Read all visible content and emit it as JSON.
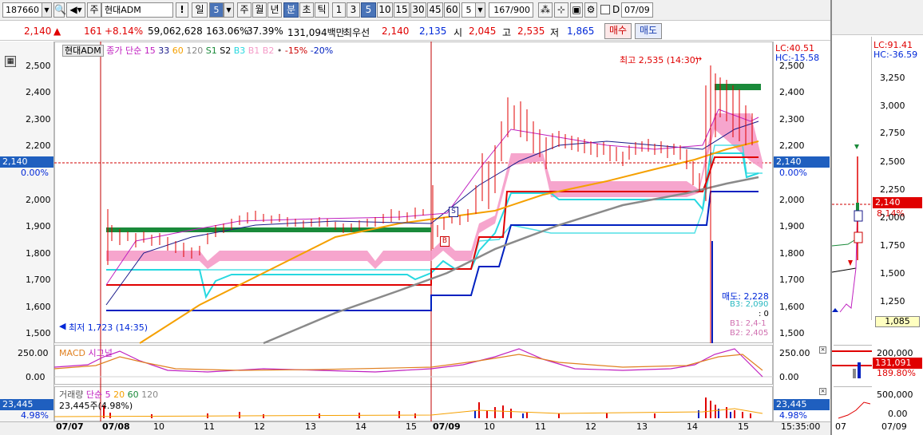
{
  "toolbar": {
    "code": "187660",
    "stock_name": "현대ADM",
    "stock_prefix": "주",
    "period_day": "일",
    "period_num": "5",
    "period_week": "주",
    "period_month": "월",
    "period_year": "년",
    "period_min": "분",
    "period_sec": "초",
    "period_tick": "틱",
    "intervals": [
      "1",
      "3",
      "5",
      "10",
      "15",
      "30",
      "45",
      "60"
    ],
    "interval_value": "5",
    "count": "167/900",
    "date_checkbox_label": "D",
    "date_value": "07/09"
  },
  "quote": {
    "price": "2,140",
    "change": "161",
    "change_pct": "+8.14%",
    "volume": "59,062,628",
    "volume_ratio": "163.06%",
    "turnover": "37.39%",
    "amount": "131,094백만",
    "best_label": "최우선",
    "ask": "2,140",
    "bid": "2,135",
    "open_label": "시",
    "open": "2,045",
    "high_label": "고",
    "high": "2,535",
    "low_label": "저",
    "low": "1,865",
    "buy_button": "매수",
    "sell_button": "매도"
  },
  "main_chart": {
    "legend": {
      "name": "현대ADM",
      "close": "종가",
      "ma_type": "단순",
      "ma15": "15",
      "ma33": "33",
      "ma60": "60",
      "ma120": "120",
      "s1": "S1",
      "s2": "S2",
      "b3": "B3",
      "b1": "B1",
      "b2": "B2",
      "dot": "•",
      "m15": "-15%",
      "m20": "-20%"
    },
    "lc": "LC:40.51",
    "hc": "HC:-15.58",
    "price_ticks": [
      "2,500",
      "2,400",
      "2,300",
      "2,200",
      "2,100",
      "2,000",
      "1,900",
      "1,800",
      "1,700",
      "1,600",
      "1,500"
    ],
    "current_price": "2,140",
    "current_pct": "0.00%",
    "high_note": "최고 2,535 (14:30)",
    "low_note": "최저 1,723 (14:35)",
    "signals": {
      "sell_label": "매도: 2,228",
      "b3": "B3: 2,090",
      "zero": ": 0",
      "b1": "B1: 2,4-1",
      "b2": "B2: 2,405"
    }
  },
  "macd": {
    "title": "MACD",
    "signal": "시그널",
    "ticks": [
      "250.00",
      "0.00"
    ]
  },
  "volume": {
    "title": "거래량",
    "ma_type": "단순",
    "ma5": "5",
    "ma20": "20",
    "ma60": "60",
    "ma120": "120",
    "current": "23,445주(4.98%)",
    "tag_value": "23,445",
    "tag_pct": "4.98%"
  },
  "dates": [
    "07/07",
    "07/08",
    "10",
    "11",
    "12",
    "13",
    "14",
    "15",
    "07/09",
    "10",
    "11",
    "12",
    "13",
    "14",
    "15",
    "15:35:00"
  ],
  "right_panel": {
    "lc": "LC:91.41",
    "hc": "HC:-36.59",
    "ticks": [
      "3,250",
      "3,000",
      "2,750",
      "2,500",
      "2,250",
      "2,000",
      "1,750",
      "1,500",
      "1,250"
    ],
    "current_price": "2,140",
    "current_pct": "8.14%",
    "low_tag": "1,085",
    "macd_ticks": [
      "200,000",
      "131,091",
      "189.80%"
    ],
    "vol_ticks": [
      "500,000",
      "0.00"
    ],
    "dates": [
      "07",
      "07/09"
    ]
  },
  "colors": {
    "accent_blue": "#4a74b8",
    "up_red": "#e00000",
    "down_blue": "#0028d8",
    "pink_band": "#f59bc8",
    "green_line": "#1a8a3a"
  }
}
